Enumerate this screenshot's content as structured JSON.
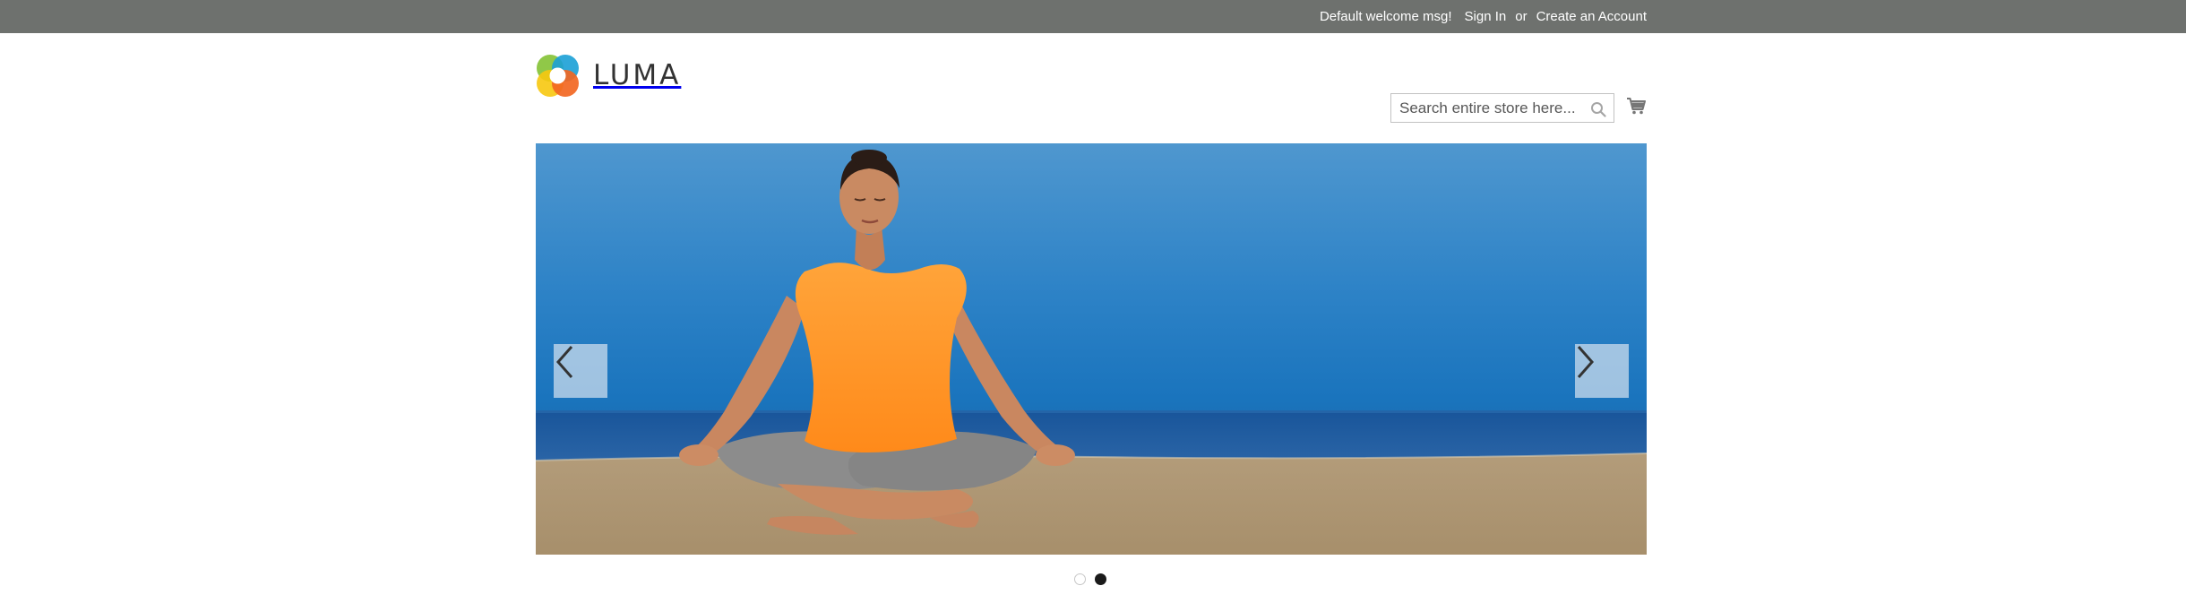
{
  "topbar": {
    "welcome": "Default welcome msg!",
    "sign_in": "Sign In",
    "or": "or",
    "create_account": "Create an Account",
    "bg_color": "#6e716e"
  },
  "header": {
    "logo_text": "LUMA",
    "search": {
      "placeholder": "Search entire store here..."
    },
    "icons": [
      "search-icon",
      "cart-icon"
    ]
  },
  "slider": {
    "prev_icon": "chevron-left-icon",
    "next_icon": "chevron-right-icon",
    "active_slide": 2,
    "slide_count": 2
  }
}
